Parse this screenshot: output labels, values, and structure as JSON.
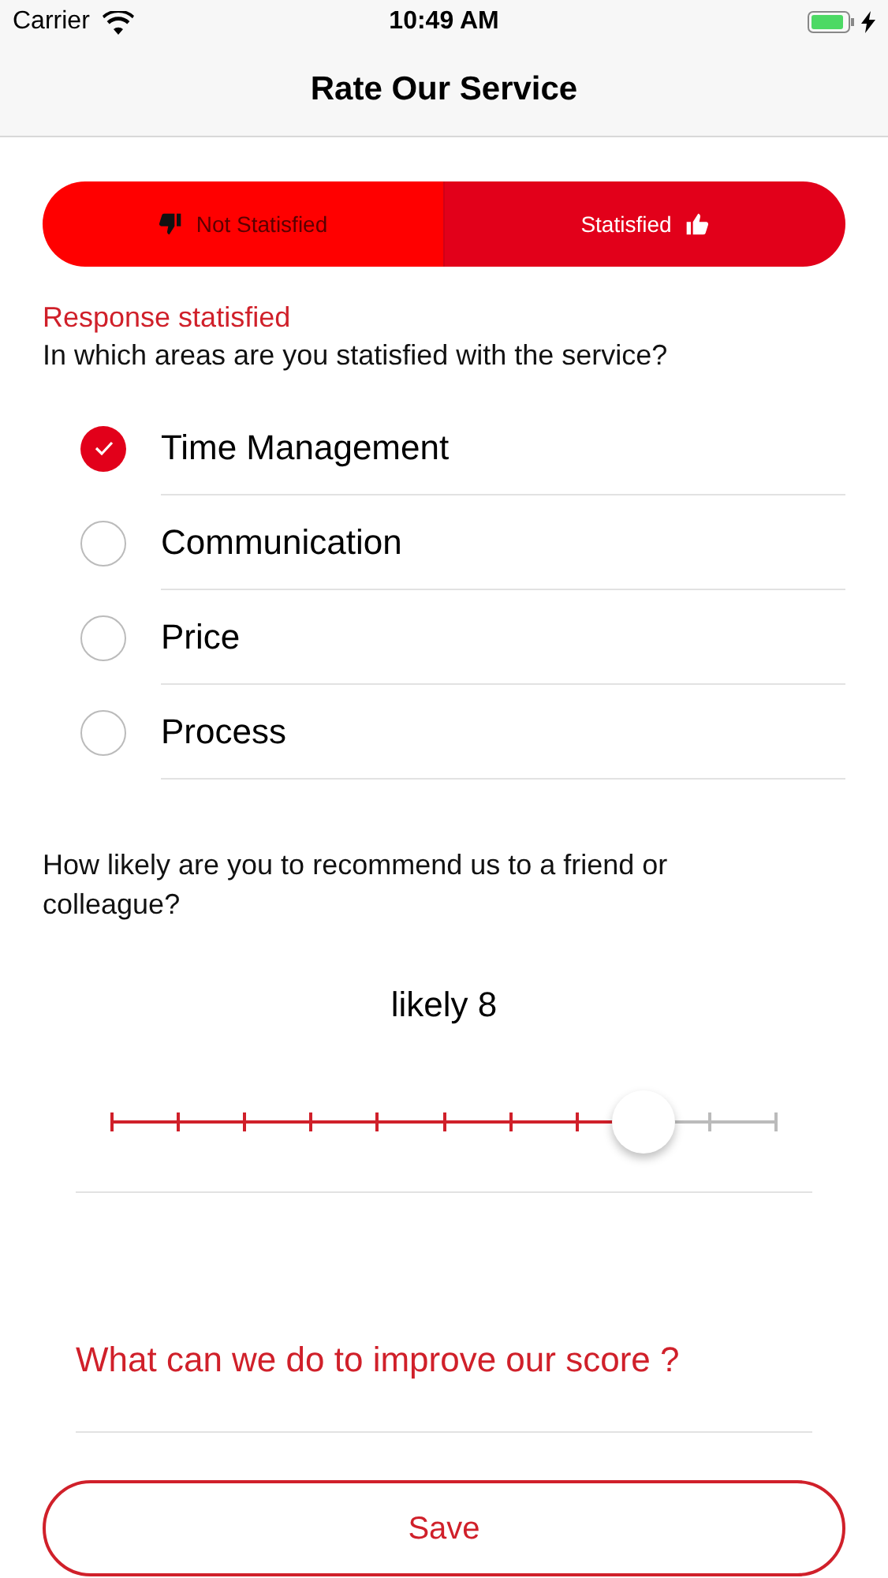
{
  "status_bar": {
    "carrier": "Carrier",
    "time": "10:49 AM"
  },
  "nav": {
    "title": "Rate Our Service"
  },
  "segments": [
    {
      "label": "Not Statisfied",
      "kind": "down",
      "selected": false
    },
    {
      "label": "Statisfied",
      "kind": "up",
      "selected": true
    }
  ],
  "response_label": "Response statisfied",
  "areas_question": "In which areas are you statisfied with the service?",
  "areas": [
    {
      "label": "Time Management",
      "checked": true
    },
    {
      "label": "Communication",
      "checked": false
    },
    {
      "label": "Price",
      "checked": false
    },
    {
      "label": "Process",
      "checked": false
    }
  ],
  "recommend_question": "How likely are you to recommend us to a friend or colleague?",
  "rating": {
    "reading": "likely 8",
    "level": 0.8
  },
  "improve_field": {
    "placeholder": "What can we do to improve our score ?"
  },
  "save_button": "Save"
}
